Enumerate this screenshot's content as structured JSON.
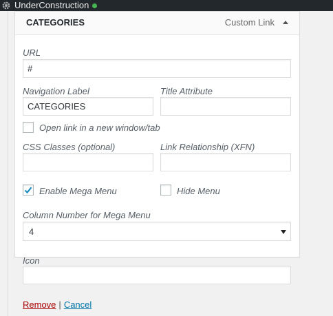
{
  "adminbar": {
    "site_name": "UnderConstruction",
    "site_icon": "gear-icon",
    "status_color": "#46b450"
  },
  "menu_item": {
    "title": "CATEGORIES",
    "type_label": "Custom Link",
    "toggle_icon": "arrow-up-icon",
    "url": {
      "label": "URL",
      "value": "#"
    },
    "navigation_label": {
      "label": "Navigation Label",
      "value": "CATEGORIES"
    },
    "title_attribute": {
      "label": "Title Attribute",
      "value": ""
    },
    "open_new_tab": {
      "label": "Open link in a new window/tab",
      "checked": false
    },
    "css_classes": {
      "label": "CSS Classes (optional)",
      "value": ""
    },
    "link_relationship": {
      "label": "Link Relationship (XFN)",
      "value": ""
    },
    "enable_mega_menu": {
      "label": "Enable Mega Menu",
      "checked": true
    },
    "hide_menu": {
      "label": "Hide Menu",
      "checked": false
    },
    "column_number": {
      "label": "Column Number for Mega Menu",
      "value": "4"
    },
    "icon": {
      "label": "Icon",
      "value": ""
    }
  },
  "actions": {
    "remove_label": "Remove",
    "separator": "|",
    "cancel_label": "Cancel"
  },
  "colors": {
    "admin_bar": "#23282d",
    "remove_link": "#aa0000",
    "cancel_link": "#0073aa",
    "checkmark": "#1e8cbe"
  }
}
